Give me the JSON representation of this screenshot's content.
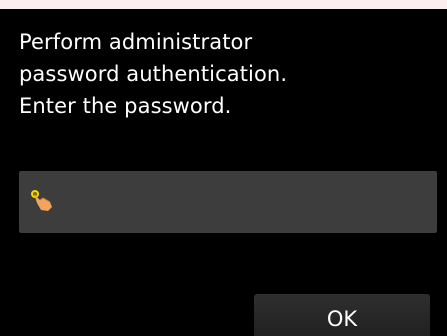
{
  "dialog": {
    "message_lines": [
      "Perform administrator",
      "password authentication.",
      "Enter the password."
    ],
    "password_field": {
      "value": "",
      "icon": "tap-finger-icon"
    },
    "ok_label": "OK"
  },
  "colors": {
    "background": "#000000",
    "field": "#3d3d3d",
    "button": "#262626",
    "text": "#ffffff",
    "icon_finger": "#f1a45c",
    "icon_tap": "#f5d800"
  }
}
